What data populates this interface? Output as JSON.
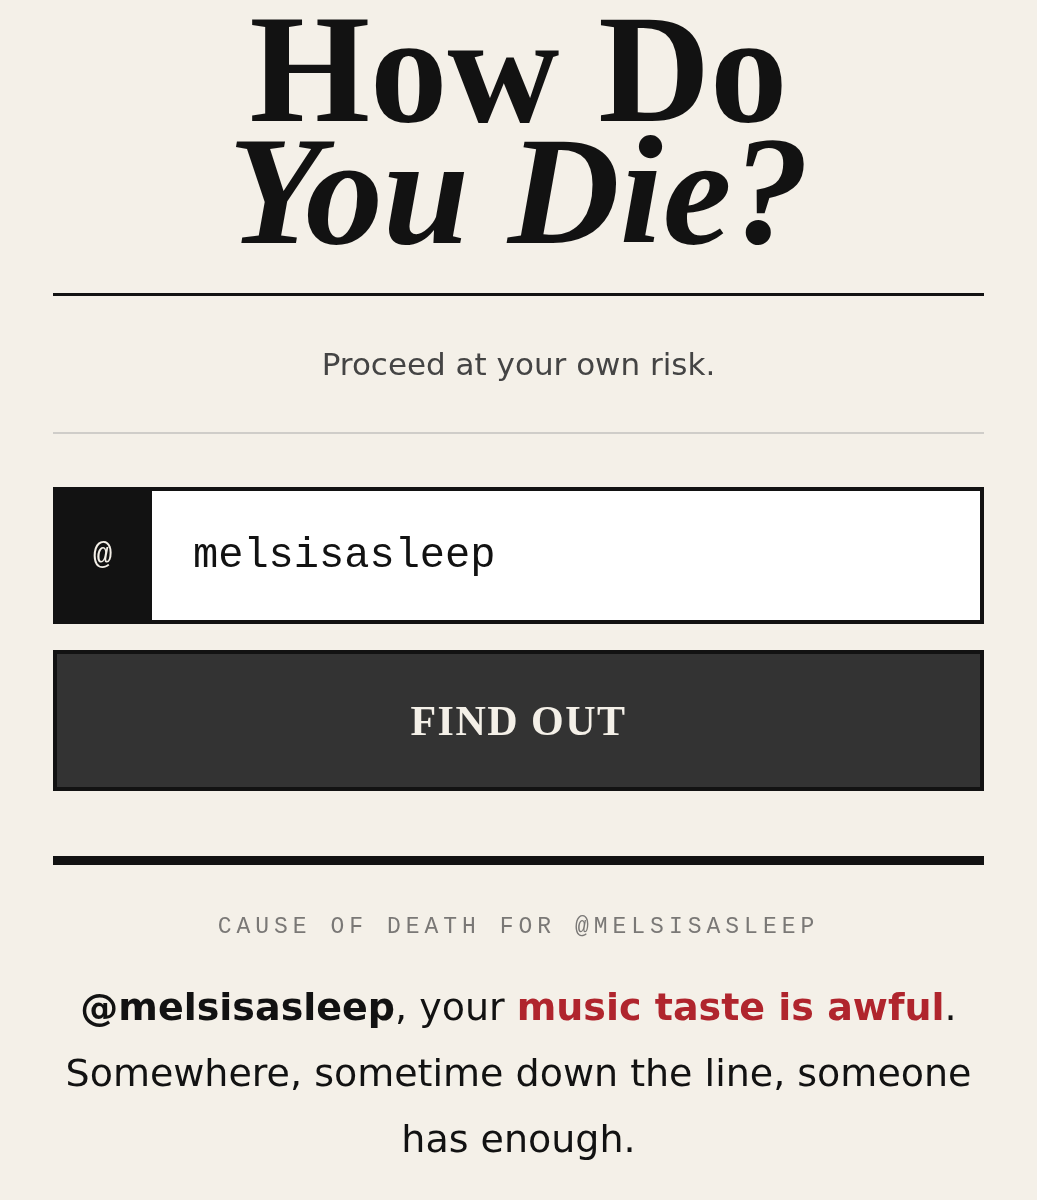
{
  "title": "How Do *You Die?*",
  "tagline": "Proceed at your own risk.",
  "username_field": {
    "prefix": "@",
    "value": "melsisasleep"
  },
  "submit_button": {
    "label": "FIND OUT"
  },
  "result": {
    "caption": "CAUSE OF DEATH FOR @MELSISASLEEP",
    "message": [
      {
        "kind": "handle",
        "text": "@melsisasleep"
      },
      {
        "kind": "plain",
        "text": ", your "
      },
      {
        "kind": "cause",
        "text": "music taste is awful"
      },
      {
        "kind": "plain",
        "text": ". Somewhere, sometime down the line, someone has enough."
      }
    ]
  }
}
